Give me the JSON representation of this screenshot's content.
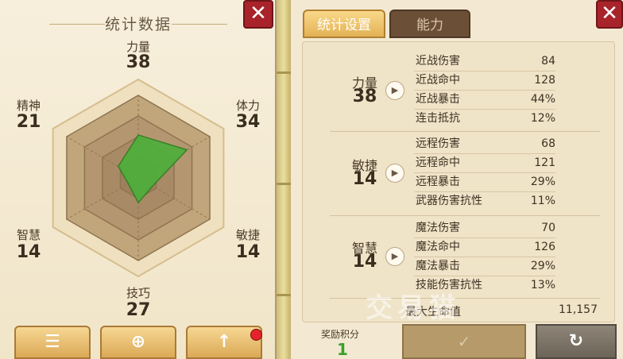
{
  "left": {
    "title": "统计数据",
    "stats": [
      {
        "label": "力量",
        "value": "38"
      },
      {
        "label": "体力",
        "value": "34"
      },
      {
        "label": "敏捷",
        "value": "14"
      },
      {
        "label": "技巧",
        "value": "27"
      },
      {
        "label": "智慧",
        "value": "14"
      },
      {
        "label": "精神",
        "value": "21"
      }
    ],
    "radar_levels": {
      "力量": 0.52,
      "体力": 0.68,
      "敏捷": 0.2,
      "技巧": 0.3,
      "智慧": 0.14,
      "精神": 0.28
    },
    "buttons": {
      "list": "list-icon",
      "zoom": "zoom-icon",
      "upgrade": "arrow-up-icon"
    }
  },
  "right": {
    "tabs": [
      {
        "label": "统计设置",
        "active": true
      },
      {
        "label": "能力",
        "active": false
      }
    ],
    "groups": [
      {
        "name": "力量",
        "value": "38",
        "rows": [
          {
            "name": "近战伤害",
            "value": "84"
          },
          {
            "name": "近战命中",
            "value": "128"
          },
          {
            "name": "近战暴击",
            "value": "44%"
          },
          {
            "name": "连击抵抗",
            "value": "12%"
          }
        ]
      },
      {
        "name": "敏捷",
        "value": "14",
        "rows": [
          {
            "name": "远程伤害",
            "value": "68"
          },
          {
            "name": "远程命中",
            "value": "121"
          },
          {
            "name": "远程暴击",
            "value": "29%"
          },
          {
            "name": "武器伤害抗性",
            "value": "11%"
          }
        ]
      },
      {
        "name": "智慧",
        "value": "14",
        "rows": [
          {
            "name": "魔法伤害",
            "value": "70"
          },
          {
            "name": "魔法命中",
            "value": "126"
          },
          {
            "name": "魔法暴击",
            "value": "29%"
          },
          {
            "name": "技能伤害抗性",
            "value": "13%"
          }
        ]
      }
    ],
    "hp": {
      "name": "最大生命值",
      "value": "11,157"
    },
    "reward": {
      "label": "奖励积分",
      "value": "1"
    },
    "confirm_icon": "✓",
    "reset_icon": "↻",
    "watermark": "交易猫"
  },
  "colors": {
    "radar_fill": "#4caf3a",
    "panel_bg": "#f3e9d2",
    "close_red": "#a8232a"
  }
}
